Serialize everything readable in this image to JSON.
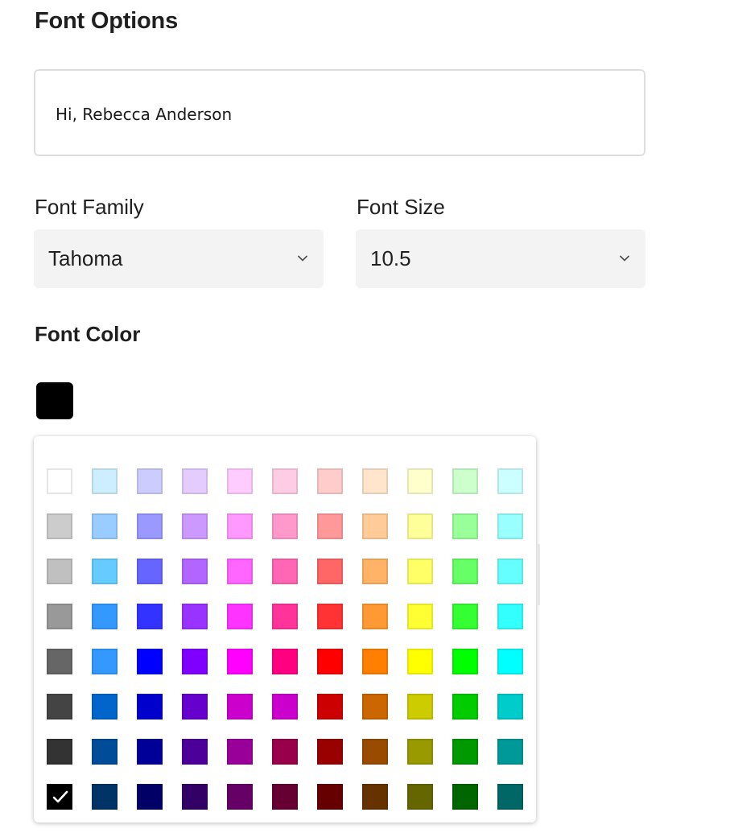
{
  "header": {
    "title": "Font Options"
  },
  "preview": {
    "text": "Hi, Rebecca Anderson"
  },
  "font_family": {
    "label": "Font Family",
    "value": "Tahoma"
  },
  "font_size": {
    "label": "Font Size",
    "value": "10.5"
  },
  "font_color": {
    "label": "Font Color",
    "selected": "#000000"
  },
  "palette": {
    "rows": [
      [
        "#ffffff",
        "#cceeff",
        "#ccccff",
        "#e5ccff",
        "#ffccff",
        "#ffcce5",
        "#ffcccc",
        "#ffe5cc",
        "#ffffcc",
        "#ccffcc",
        "#ccffff"
      ],
      [
        "#cccccc",
        "#99ccff",
        "#9999ff",
        "#cc99ff",
        "#ff99ff",
        "#ff99cc",
        "#ff9999",
        "#ffcc99",
        "#ffff99",
        "#99ff99",
        "#99ffff"
      ],
      [
        "#c0c0c0",
        "#66ccff",
        "#6666ff",
        "#b366ff",
        "#ff66ff",
        "#ff66b3",
        "#ff6666",
        "#ffb366",
        "#ffff66",
        "#66ff66",
        "#66ffff"
      ],
      [
        "#999999",
        "#3399ff",
        "#3333ff",
        "#9933ff",
        "#ff33ff",
        "#ff3399",
        "#ff3333",
        "#ff9933",
        "#ffff33",
        "#33ff33",
        "#33ffff"
      ],
      [
        "#666666",
        "#3399ff",
        "#0000ff",
        "#8000ff",
        "#ff00ff",
        "#ff0080",
        "#ff0000",
        "#ff8000",
        "#ffff00",
        "#00ff00",
        "#00ffff"
      ],
      [
        "#444444",
        "#0066cc",
        "#0000cc",
        "#6600cc",
        "#cc00cc",
        "#cc00cc",
        "#cc0000",
        "#cc6600",
        "#cccc00",
        "#00cc00",
        "#00cccc"
      ],
      [
        "#333333",
        "#004c99",
        "#000099",
        "#4c0099",
        "#990099",
        "#99004c",
        "#990000",
        "#994c00",
        "#999900",
        "#009900",
        "#009999"
      ],
      [
        "#000000",
        "#003366",
        "#000066",
        "#330066",
        "#660066",
        "#660033",
        "#660000",
        "#663300",
        "#666600",
        "#006600",
        "#006666"
      ]
    ],
    "selected_row": 7,
    "selected_col": 0,
    "checkmark_icon": "check-icon"
  },
  "icons": {
    "dropdown": "chevron-down-icon"
  }
}
